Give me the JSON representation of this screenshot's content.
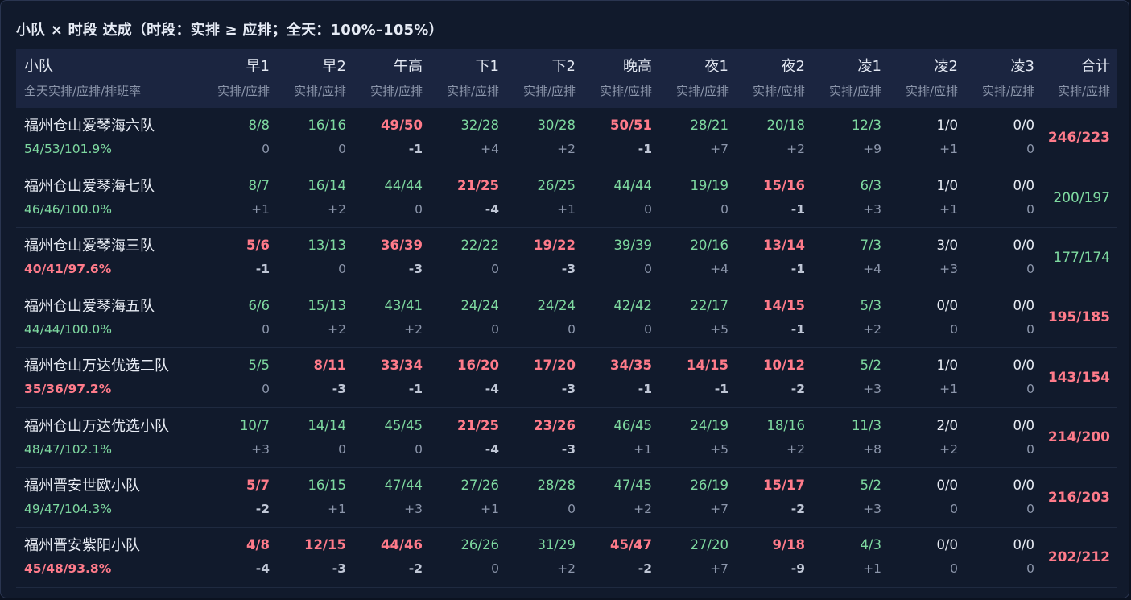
{
  "title": "小队 × 时段 达成（时段：实排 ≥ 应排；全天：100%–105%）",
  "header": {
    "team_label": "小队",
    "team_sub": "全天实排/应排/排班率",
    "slots": [
      "早1",
      "早2",
      "午高",
      "下1",
      "下2",
      "晚高",
      "夜1",
      "夜2",
      "凌1",
      "凌2",
      "凌3"
    ],
    "slot_sub": "实排/应排",
    "total_label": "合计",
    "total_sub": "实排/应排"
  },
  "colors": {
    "good": "#7ed9a0",
    "bad": "#ff7b8a",
    "neutral": "#e8ecf4",
    "header_bg": "#1b2540",
    "panel_bg": "#111a2c"
  },
  "rows": [
    {
      "name": "福州仓山爱琴海六队",
      "rate": "54/53/101.9%",
      "rate_status": "good",
      "cells": [
        {
          "v": "8/8",
          "d": "0",
          "s": "good"
        },
        {
          "v": "16/16",
          "d": "0",
          "s": "good"
        },
        {
          "v": "49/50",
          "d": "-1",
          "s": "bad"
        },
        {
          "v": "32/28",
          "d": "+4",
          "s": "good"
        },
        {
          "v": "30/28",
          "d": "+2",
          "s": "good"
        },
        {
          "v": "50/51",
          "d": "-1",
          "s": "bad"
        },
        {
          "v": "28/21",
          "d": "+7",
          "s": "good"
        },
        {
          "v": "20/18",
          "d": "+2",
          "s": "good"
        },
        {
          "v": "12/3",
          "d": "+9",
          "s": "good"
        },
        {
          "v": "1/0",
          "d": "+1",
          "s": "neutral"
        },
        {
          "v": "0/0",
          "d": "0",
          "s": "neutral"
        }
      ],
      "total": "246/223",
      "total_status": "bad"
    },
    {
      "name": "福州仓山爱琴海七队",
      "rate": "46/46/100.0%",
      "rate_status": "good",
      "cells": [
        {
          "v": "8/7",
          "d": "+1",
          "s": "good"
        },
        {
          "v": "16/14",
          "d": "+2",
          "s": "good"
        },
        {
          "v": "44/44",
          "d": "0",
          "s": "good"
        },
        {
          "v": "21/25",
          "d": "-4",
          "s": "bad"
        },
        {
          "v": "26/25",
          "d": "+1",
          "s": "good"
        },
        {
          "v": "44/44",
          "d": "0",
          "s": "good"
        },
        {
          "v": "19/19",
          "d": "0",
          "s": "good"
        },
        {
          "v": "15/16",
          "d": "-1",
          "s": "bad"
        },
        {
          "v": "6/3",
          "d": "+3",
          "s": "good"
        },
        {
          "v": "1/0",
          "d": "+1",
          "s": "neutral"
        },
        {
          "v": "0/0",
          "d": "0",
          "s": "neutral"
        }
      ],
      "total": "200/197",
      "total_status": "good"
    },
    {
      "name": "福州仓山爱琴海三队",
      "rate": "40/41/97.6%",
      "rate_status": "bad",
      "cells": [
        {
          "v": "5/6",
          "d": "-1",
          "s": "bad"
        },
        {
          "v": "13/13",
          "d": "0",
          "s": "good"
        },
        {
          "v": "36/39",
          "d": "-3",
          "s": "bad"
        },
        {
          "v": "22/22",
          "d": "0",
          "s": "good"
        },
        {
          "v": "19/22",
          "d": "-3",
          "s": "bad"
        },
        {
          "v": "39/39",
          "d": "0",
          "s": "good"
        },
        {
          "v": "20/16",
          "d": "+4",
          "s": "good"
        },
        {
          "v": "13/14",
          "d": "-1",
          "s": "bad"
        },
        {
          "v": "7/3",
          "d": "+4",
          "s": "good"
        },
        {
          "v": "3/0",
          "d": "+3",
          "s": "neutral"
        },
        {
          "v": "0/0",
          "d": "0",
          "s": "neutral"
        }
      ],
      "total": "177/174",
      "total_status": "good"
    },
    {
      "name": "福州仓山爱琴海五队",
      "rate": "44/44/100.0%",
      "rate_status": "good",
      "cells": [
        {
          "v": "6/6",
          "d": "0",
          "s": "good"
        },
        {
          "v": "15/13",
          "d": "+2",
          "s": "good"
        },
        {
          "v": "43/41",
          "d": "+2",
          "s": "good"
        },
        {
          "v": "24/24",
          "d": "0",
          "s": "good"
        },
        {
          "v": "24/24",
          "d": "0",
          "s": "good"
        },
        {
          "v": "42/42",
          "d": "0",
          "s": "good"
        },
        {
          "v": "22/17",
          "d": "+5",
          "s": "good"
        },
        {
          "v": "14/15",
          "d": "-1",
          "s": "bad"
        },
        {
          "v": "5/3",
          "d": "+2",
          "s": "good"
        },
        {
          "v": "0/0",
          "d": "0",
          "s": "neutral"
        },
        {
          "v": "0/0",
          "d": "0",
          "s": "neutral"
        }
      ],
      "total": "195/185",
      "total_status": "bad"
    },
    {
      "name": "福州仓山万达优选二队",
      "rate": "35/36/97.2%",
      "rate_status": "bad",
      "cells": [
        {
          "v": "5/5",
          "d": "0",
          "s": "good"
        },
        {
          "v": "8/11",
          "d": "-3",
          "s": "bad"
        },
        {
          "v": "33/34",
          "d": "-1",
          "s": "bad"
        },
        {
          "v": "16/20",
          "d": "-4",
          "s": "bad"
        },
        {
          "v": "17/20",
          "d": "-3",
          "s": "bad"
        },
        {
          "v": "34/35",
          "d": "-1",
          "s": "bad"
        },
        {
          "v": "14/15",
          "d": "-1",
          "s": "bad"
        },
        {
          "v": "10/12",
          "d": "-2",
          "s": "bad"
        },
        {
          "v": "5/2",
          "d": "+3",
          "s": "good"
        },
        {
          "v": "1/0",
          "d": "+1",
          "s": "neutral"
        },
        {
          "v": "0/0",
          "d": "0",
          "s": "neutral"
        }
      ],
      "total": "143/154",
      "total_status": "bad"
    },
    {
      "name": "福州仓山万达优选小队",
      "rate": "48/47/102.1%",
      "rate_status": "good",
      "cells": [
        {
          "v": "10/7",
          "d": "+3",
          "s": "good"
        },
        {
          "v": "14/14",
          "d": "0",
          "s": "good"
        },
        {
          "v": "45/45",
          "d": "0",
          "s": "good"
        },
        {
          "v": "21/25",
          "d": "-4",
          "s": "bad"
        },
        {
          "v": "23/26",
          "d": "-3",
          "s": "bad"
        },
        {
          "v": "46/45",
          "d": "+1",
          "s": "good"
        },
        {
          "v": "24/19",
          "d": "+5",
          "s": "good"
        },
        {
          "v": "18/16",
          "d": "+2",
          "s": "good"
        },
        {
          "v": "11/3",
          "d": "+8",
          "s": "good"
        },
        {
          "v": "2/0",
          "d": "+2",
          "s": "neutral"
        },
        {
          "v": "0/0",
          "d": "0",
          "s": "neutral"
        }
      ],
      "total": "214/200",
      "total_status": "bad"
    },
    {
      "name": "福州晋安世欧小队",
      "rate": "49/47/104.3%",
      "rate_status": "good",
      "cells": [
        {
          "v": "5/7",
          "d": "-2",
          "s": "bad"
        },
        {
          "v": "16/15",
          "d": "+1",
          "s": "good"
        },
        {
          "v": "47/44",
          "d": "+3",
          "s": "good"
        },
        {
          "v": "27/26",
          "d": "+1",
          "s": "good"
        },
        {
          "v": "28/28",
          "d": "0",
          "s": "good"
        },
        {
          "v": "47/45",
          "d": "+2",
          "s": "good"
        },
        {
          "v": "26/19",
          "d": "+7",
          "s": "good"
        },
        {
          "v": "15/17",
          "d": "-2",
          "s": "bad"
        },
        {
          "v": "5/2",
          "d": "+3",
          "s": "good"
        },
        {
          "v": "0/0",
          "d": "0",
          "s": "neutral"
        },
        {
          "v": "0/0",
          "d": "0",
          "s": "neutral"
        }
      ],
      "total": "216/203",
      "total_status": "bad"
    },
    {
      "name": "福州晋安紫阳小队",
      "rate": "45/48/93.8%",
      "rate_status": "bad",
      "cells": [
        {
          "v": "4/8",
          "d": "-4",
          "s": "bad"
        },
        {
          "v": "12/15",
          "d": "-3",
          "s": "bad"
        },
        {
          "v": "44/46",
          "d": "-2",
          "s": "bad"
        },
        {
          "v": "26/26",
          "d": "0",
          "s": "good"
        },
        {
          "v": "31/29",
          "d": "+2",
          "s": "good"
        },
        {
          "v": "45/47",
          "d": "-2",
          "s": "bad"
        },
        {
          "v": "27/20",
          "d": "+7",
          "s": "good"
        },
        {
          "v": "9/18",
          "d": "-9",
          "s": "bad"
        },
        {
          "v": "4/3",
          "d": "+1",
          "s": "good"
        },
        {
          "v": "0/0",
          "d": "0",
          "s": "neutral"
        },
        {
          "v": "0/0",
          "d": "0",
          "s": "neutral"
        }
      ],
      "total": "202/212",
      "total_status": "bad"
    }
  ]
}
